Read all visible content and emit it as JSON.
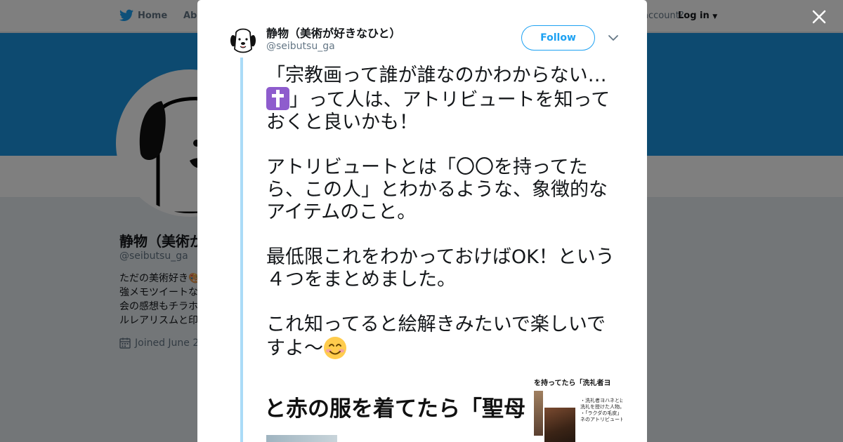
{
  "nav": {
    "home_label": "Home",
    "about_label": "Abo",
    "account_prompt": "account?",
    "login_label": "Log in"
  },
  "profile": {
    "name": "静物（美術が",
    "handle": "@seibutsu_ga",
    "bio_lines": [
      "ただの美術好き🎨",
      "強メモツイートな",
      "会の感想もチラホ",
      "ルレアリスムと印"
    ],
    "joined": "Joined June 2"
  },
  "tweet": {
    "author_name": "静物（美術が好きなひと）",
    "author_handle": "@seibutsu_ga",
    "follow_label": "Follow",
    "paragraphs": {
      "p1_a": "「宗教画って誰が誰なのかわからない…",
      "p1_b": "」って人は、アトリビュートを知っておくと良いかも！",
      "p2": "アトリビュートとは「〇〇を持ってたら、この人」とわかるような、象徴的なアイテムのこと。",
      "p3": "最低限これをわかっておけばOK！という４つをまとめました。",
      "p4": "これ知ってると絵解きみたいで楽しいですよ～"
    },
    "emojis": [
      "latin-cross",
      "smiling-face-with-smiling-eyes"
    ],
    "image": {
      "caption": "と赤の服を着てたら「聖母",
      "right_title": "を持ってたら「洗礼者ヨ",
      "note_lines": [
        "・洗礼者ヨハネとは",
        "洗礼を授けた人物。",
        "・「ラクダの毛皮」",
        "ネのアトリビュート"
      ]
    }
  },
  "colors": {
    "brand_blue": "#1da1f2",
    "banner_blue": "#1b95e0",
    "thread_line": "#aadbf7",
    "emoji_purple": "#8e5ccd"
  }
}
